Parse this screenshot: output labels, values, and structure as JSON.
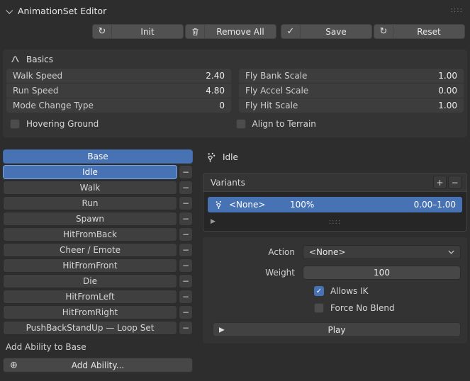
{
  "colors": {
    "accent": "#4772b3",
    "background": "#2d2d2d",
    "selected_outline": "#7ea6da"
  },
  "icons": {
    "refresh": "↻",
    "check": "✓",
    "minus": "−",
    "plus": "+",
    "plus_circle": "⊕",
    "play": "▶",
    "expander": "▶",
    "grip": "::::"
  },
  "header": {
    "title": "AnimationSet Editor",
    "grip": "::::"
  },
  "toolbar": {
    "buttons": [
      {
        "icon": "refresh-icon",
        "label": "Init"
      },
      {
        "icon": "trash-icon",
        "label": "Remove All"
      },
      {
        "icon": "check-icon",
        "label": "Save"
      },
      {
        "icon": "refresh-icon",
        "label": "Reset"
      }
    ]
  },
  "basics": {
    "title": "Basics",
    "left_fields": [
      {
        "label": "Walk Speed",
        "value": "2.40"
      },
      {
        "label": "Run Speed",
        "value": "4.80"
      },
      {
        "label": "Mode Change Type",
        "value": "0"
      }
    ],
    "right_fields": [
      {
        "label": "Fly Bank Scale",
        "value": "1.00"
      },
      {
        "label": "Fly Accel Scale",
        "value": "0.00"
      },
      {
        "label": "Fly Hit Scale",
        "value": "1.00"
      }
    ],
    "checkboxes": [
      {
        "label": "Hovering Ground",
        "checked": false
      },
      {
        "label": "Align to Terrain",
        "checked": false
      }
    ]
  },
  "anim_list": {
    "items": [
      {
        "label": "Base",
        "selected": true,
        "removable": false
      },
      {
        "label": "Idle",
        "selected": true,
        "removable": true
      },
      {
        "label": "Walk",
        "selected": false,
        "removable": true
      },
      {
        "label": "Run",
        "selected": false,
        "removable": true
      },
      {
        "label": "Spawn",
        "selected": false,
        "removable": true
      },
      {
        "label": "HitFromBack",
        "selected": false,
        "removable": true
      },
      {
        "label": "Cheer / Emote",
        "selected": false,
        "removable": true
      },
      {
        "label": "HitFromFront",
        "selected": false,
        "removable": true
      },
      {
        "label": "Die",
        "selected": false,
        "removable": true
      },
      {
        "label": "HitFromLeft",
        "selected": false,
        "removable": true
      },
      {
        "label": "HitFromRight",
        "selected": false,
        "removable": true
      },
      {
        "label": "PushBackStandUp — Loop Set",
        "selected": false,
        "removable": true
      }
    ],
    "add_section_title": "Add Ability to Base",
    "add_button_label": "Add Ability..."
  },
  "detail": {
    "title": "Idle",
    "variants": {
      "title": "Variants",
      "row": {
        "name": "<None>",
        "weight": "100%",
        "range": "0.00–1.00"
      },
      "footer_grip": "::::"
    },
    "form": {
      "action_label": "Action",
      "action_value": "<None>",
      "weight_label": "Weight",
      "weight_value": "100",
      "allows_ik_label": "Allows IK",
      "allows_ik_checked": true,
      "force_no_blend_label": "Force No Blend",
      "force_no_blend_checked": false,
      "play_label": "Play"
    }
  }
}
